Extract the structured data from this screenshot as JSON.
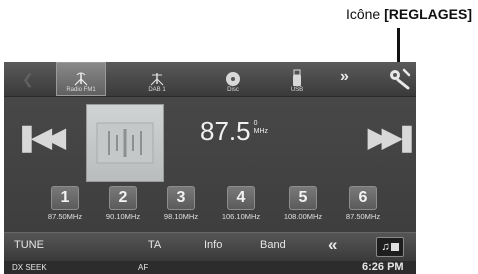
{
  "callout": {
    "prefix": "Icône ",
    "bold": "[REGLAGES]"
  },
  "sources": [
    {
      "label": "Radio FM1",
      "icon": "radio-antenna-icon",
      "active": true
    },
    {
      "label": "DAB 1",
      "icon": "dab-antenna-icon",
      "active": false
    },
    {
      "label": "Disc",
      "icon": "disc-icon",
      "active": false
    },
    {
      "label": "USB",
      "icon": "usb-icon",
      "active": false
    }
  ],
  "topbar": {
    "back_icon": "back-arrow-icon",
    "next_glyph": "»",
    "settings_icon": "wrench-icon"
  },
  "tuner": {
    "frequency": "87.5",
    "frequency_small": "0",
    "unit": "MHz"
  },
  "presets": [
    {
      "number": "1",
      "freq": "87.50MHz"
    },
    {
      "number": "2",
      "freq": "90.10MHz"
    },
    {
      "number": "3",
      "freq": "98.10MHz"
    },
    {
      "number": "4",
      "freq": "106.10MHz"
    },
    {
      "number": "5",
      "freq": "108.00MHz"
    },
    {
      "number": "6",
      "freq": "87.50MHz"
    }
  ],
  "controls": {
    "tune": "TUNE",
    "ta": "TA",
    "info": "Info",
    "band": "Band",
    "chevron": "«"
  },
  "status": {
    "mode": "DX SEEK",
    "af": "AF",
    "clock": "6:26 PM"
  },
  "colors": {
    "screen_bg": "#3b3b3b",
    "text": "#e6e6e6",
    "active_tab": "#8a8a8a"
  }
}
